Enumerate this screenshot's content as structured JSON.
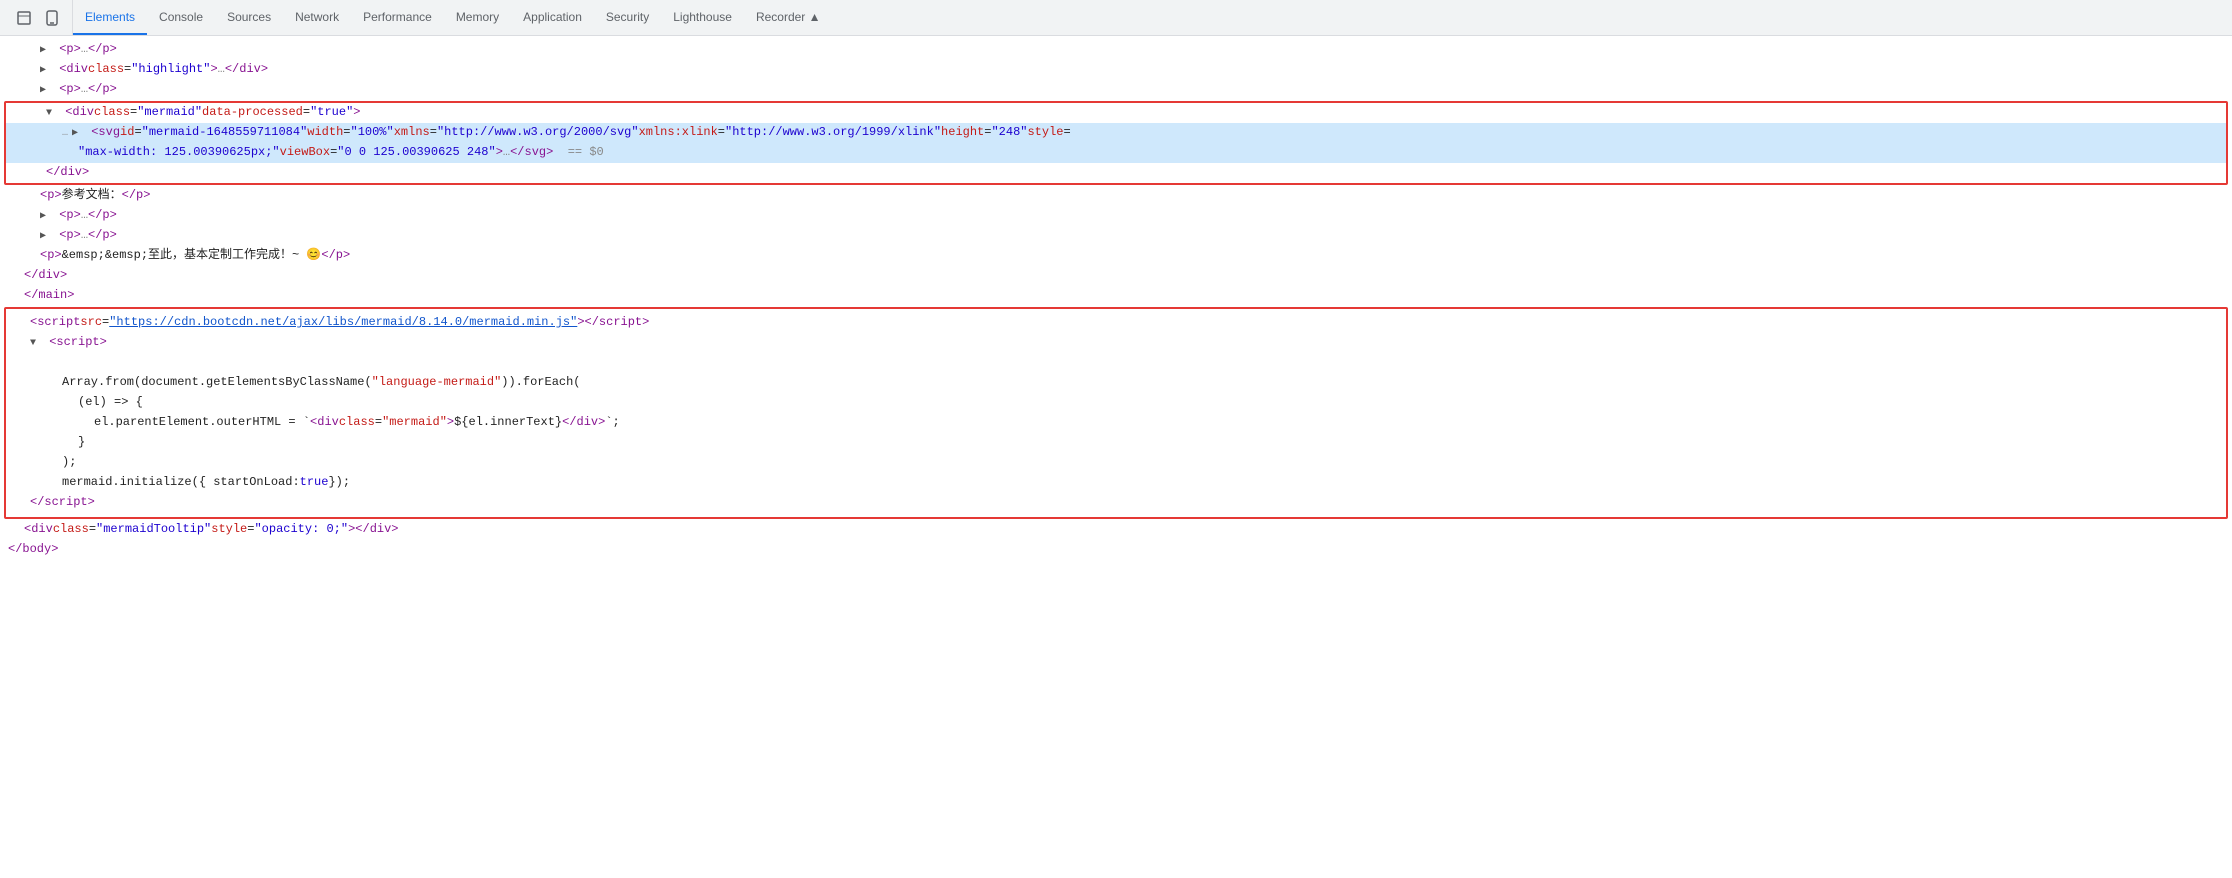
{
  "tabs": {
    "items": [
      {
        "label": "Elements",
        "active": true
      },
      {
        "label": "Console",
        "active": false
      },
      {
        "label": "Sources",
        "active": false
      },
      {
        "label": "Network",
        "active": false
      },
      {
        "label": "Performance",
        "active": false
      },
      {
        "label": "Memory",
        "active": false
      },
      {
        "label": "Application",
        "active": false
      },
      {
        "label": "Security",
        "active": false
      },
      {
        "label": "Lighthouse",
        "active": false
      },
      {
        "label": "Recorder ▲",
        "active": false
      }
    ]
  },
  "html_lines": {
    "line1": "▶  <p>…</p>",
    "line2": "▶  <div class=\"highlight\">…</div>",
    "line3": "▶  <p>…</p>",
    "div_class": "<div class=\"mermaid\" data-processed=\"true\">",
    "svg_line": "▶  <svg id=\"mermaid-1648559711084\" width=\"100%\" xmlns=\"http://www.w3.org/2000/svg\" xmlns:xlink=\"http://www.w3.org/1999/xlink\"  height=\"248\" style=",
    "svg_line2": "\"max-width: 125.00390625px;\" viewBox=\"0 0 125.00390625 248\">…</svg>  == $0",
    "div_close": "</div>",
    "p_ref": "<p>参考文档：</p>",
    "p3": "▶  <p>…</p>",
    "p4": "▶  <p>…</p>",
    "p_emsp": "<p>&emsp;&emsp;至此，基本定制工作完成！~ 😊</p>",
    "div_close2": "</div>",
    "main_close": "</main>",
    "script_src": "<script src=\"https://cdn.bootcdn.net/ajax/libs/mermaid/8.14.0/mermaid.min.js\"></script>",
    "script_open": "▼ <script>",
    "code1": "Array.from(document.getElementsByClassName(\"language-mermaid\")).forEach(",
    "code2": "(el) => {",
    "code3": "el.parentElement.outerHTML = `<div class=\"mermaid\">${el.innerText}</div>`;",
    "code4": "}",
    "code5": ");",
    "code6": "mermaid.initialize({ startOnLoad: true });",
    "script_close": "</script>",
    "div_tooltip": "<div class=\"mermaidTooltip\" style=\"opacity: 0;\"></div>",
    "body_close": "</body>"
  }
}
